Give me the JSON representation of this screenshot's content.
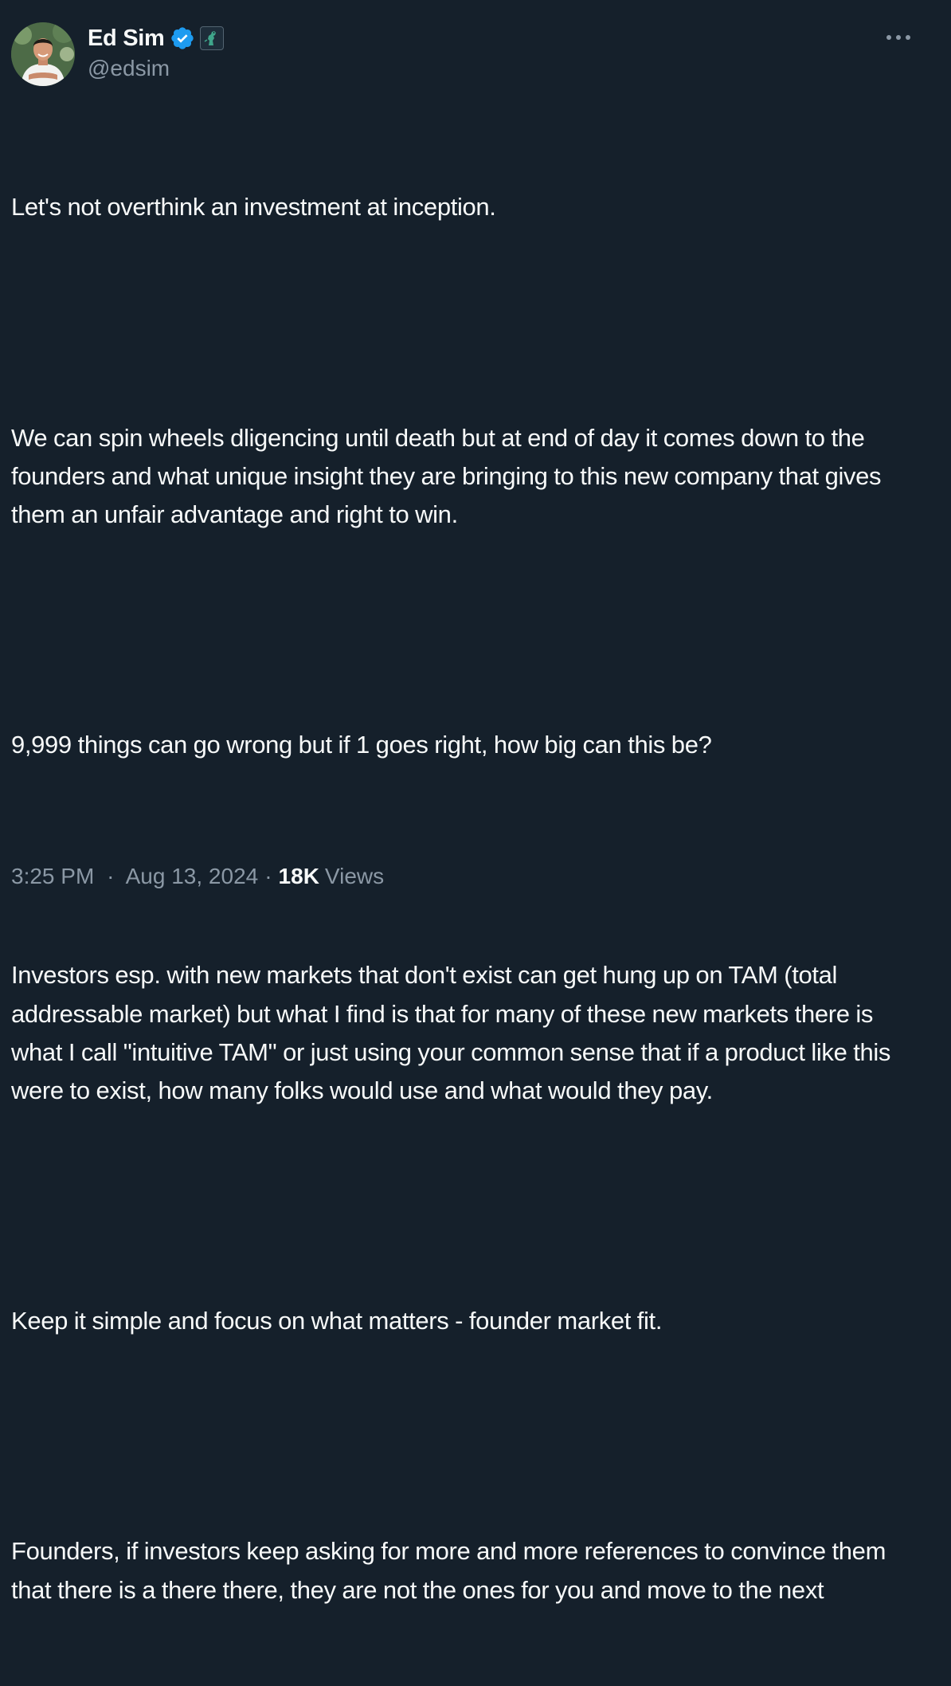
{
  "author": {
    "display_name": "Ed Sim",
    "handle": "@edsim",
    "verified": true,
    "affiliate_badge": "dinosaur-icon"
  },
  "more_icon": "more-horizontal-icon",
  "tweet": {
    "paragraphs": [
      "Let's not overthink an investment at inception.",
      "We can spin wheels dligencing until death but at end of day it comes down to the founders and what unique insight they are bringing to this new company that gives them an unfair advantage and right to win.",
      "9,999 things can go wrong but if 1 goes right, how big can this be?",
      "Investors esp. with new markets that don't exist can get hung up on TAM (total addressable market) but what I find is that for many of these new markets there is what I call \"intuitive TAM\" or just using your common sense that if a product like this were to exist, how many folks would use and what would they pay.",
      "Keep it simple and focus on what matters - founder market fit.",
      "Founders, if investors keep asking for more and more references to convince them that there is a there there, they are not the ones for you and move to the next"
    ]
  },
  "meta": {
    "time": "3:25 PM",
    "date": "Aug 13, 2024",
    "separator": "·",
    "views_count": "18K",
    "views_label": "Views"
  },
  "colors": {
    "background": "#15202b",
    "text_primary": "#f7f9f9",
    "text_secondary": "#8b98a5",
    "verified_blue": "#1d9bf0"
  }
}
